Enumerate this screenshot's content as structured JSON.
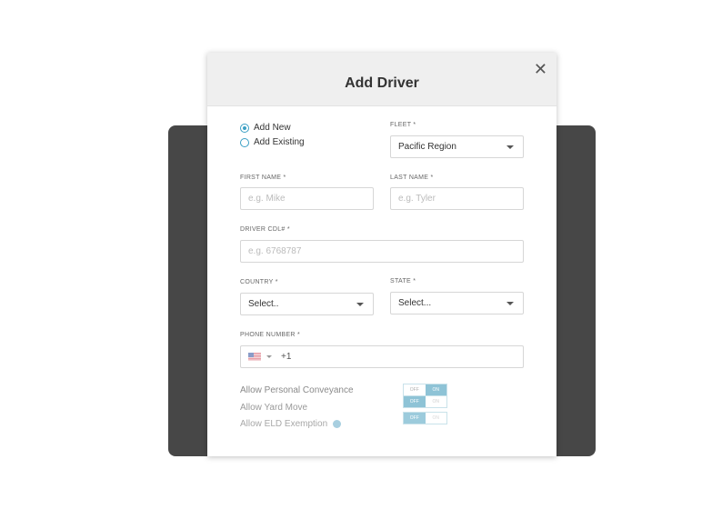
{
  "modal": {
    "title": "Add Driver",
    "close_icon": "close-icon"
  },
  "mode": {
    "options": [
      "Add New",
      "Add Existing"
    ],
    "selected": "Add New"
  },
  "fleet": {
    "label": "FLEET *",
    "value": "Pacific Region"
  },
  "first_name": {
    "label": "FIRST NAME *",
    "placeholder": "e.g. Mike"
  },
  "last_name": {
    "label": "LAST NAME *",
    "placeholder": "e.g. Tyler"
  },
  "cdl": {
    "label": "DRIVER CDL# *",
    "placeholder": "e.g. 6768787"
  },
  "country": {
    "label": "COUNTRY *",
    "value": "Select.."
  },
  "state": {
    "label": "STATE *",
    "value": "Select..."
  },
  "phone": {
    "label": "PHONE NUMBER *",
    "code": "+1"
  },
  "options": [
    {
      "label": "Allow Personal Conveyance",
      "off": "OFF",
      "on": "ON",
      "state": "ON"
    },
    {
      "label": "Allow Yard Move",
      "off": "OFF",
      "on": "ON",
      "state": "OFF"
    },
    {
      "label": "Allow ELD Exemption",
      "off": "OFF",
      "on": "ON",
      "state": "OFF"
    }
  ],
  "colors": {
    "accent": "#3a9fc4",
    "backdrop": "#474747"
  }
}
